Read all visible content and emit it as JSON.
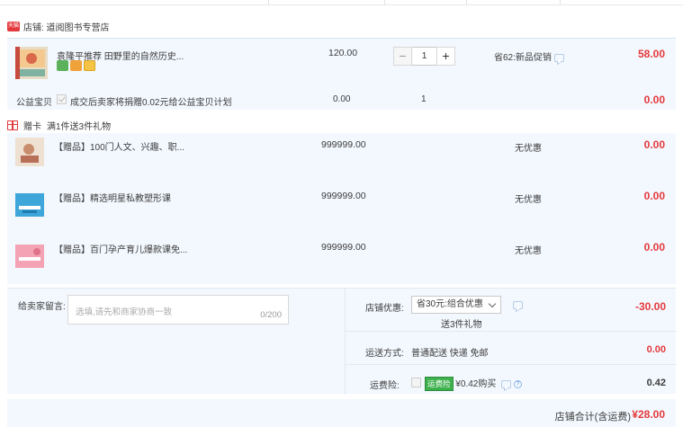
{
  "shop": {
    "name": "店铺: 道阅图书专营店",
    "badge": "天猫"
  },
  "product": {
    "title": "袁隆平推荐 田野里的自然历史...",
    "unit_price": "120.00",
    "quantity": "1",
    "promotion": "省62:新品促销",
    "subtotal": "58.00",
    "minus": "−",
    "plus": "+"
  },
  "charity": {
    "label": "公益宝贝",
    "text": "成交后卖家将捐赠0.02元给公益宝贝计划",
    "price": "0.00",
    "quantity": "1",
    "subtotal": "0.00"
  },
  "gift_header": {
    "label": "赠卡",
    "text": "满1件送3件礼物"
  },
  "gifts": [
    {
      "title": "【赠品】100门人文、兴趣、职...",
      "price": "999999.00",
      "promo": "无优惠",
      "subtotal": "0.00"
    },
    {
      "title": "【赠品】精选明星私教塑形课",
      "price": "999999.00",
      "promo": "无优惠",
      "subtotal": "0.00"
    },
    {
      "title": "【赠品】百门孕产育儿爆款课免...",
      "price": "999999.00",
      "promo": "无优惠",
      "subtotal": "0.00"
    }
  ],
  "message": {
    "label": "给卖家留言:",
    "placeholder": "选填,请先和商家协商一致",
    "counter": "0/200"
  },
  "shop_discount": {
    "label": "店铺优惠:",
    "selected": "省30元:组合优惠",
    "note": "送3件礼物",
    "amount": "-30.00"
  },
  "shipping": {
    "label": "运送方式:",
    "value": "普通配送 快递 免邮",
    "amount": "0.00"
  },
  "insurance": {
    "label": "运费险:",
    "tag": "运费险",
    "value": "¥0.42购买",
    "amount": "0.42"
  },
  "footer": {
    "label": "店铺合计(含运费)",
    "amount": "¥28.00"
  },
  "colors": {
    "accent": "#e4393c",
    "panel": "#f3f8fe"
  }
}
